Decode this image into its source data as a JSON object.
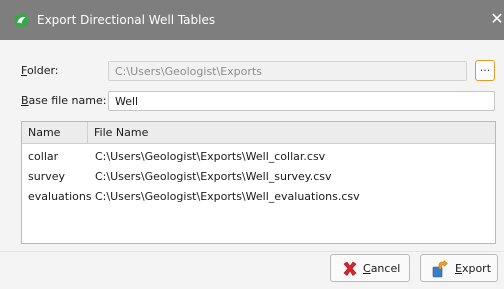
{
  "window": {
    "title": "Export Directional Well Tables",
    "close_glyph": "✕",
    "title_bar_color": "#7e7e7e",
    "app_icon": "geology-app-icon"
  },
  "folder": {
    "label_first": "F",
    "label_rest": "older:",
    "value": "C:\\Users\\Geologist\\Exports",
    "browse_label": "..."
  },
  "base_file": {
    "label_first": "B",
    "label_rest": "ase file name:",
    "value": "Well"
  },
  "table": {
    "columns": [
      "Name",
      "File Name"
    ],
    "rows": [
      {
        "name": "collar",
        "file": "C:\\Users\\Geologist\\Exports\\Well_collar.csv"
      },
      {
        "name": "survey",
        "file": "C:\\Users\\Geologist\\Exports\\Well_survey.csv"
      },
      {
        "name": "evaluations",
        "file": "C:\\Users\\Geologist\\Exports\\Well_evaluations.csv"
      }
    ]
  },
  "buttons": {
    "cancel_first": "C",
    "cancel_rest": "ancel",
    "export_first": "E",
    "export_rest": "xport"
  },
  "colors": {
    "accent": "#e29a2d",
    "dialog_bg": "#f4f4f4"
  }
}
